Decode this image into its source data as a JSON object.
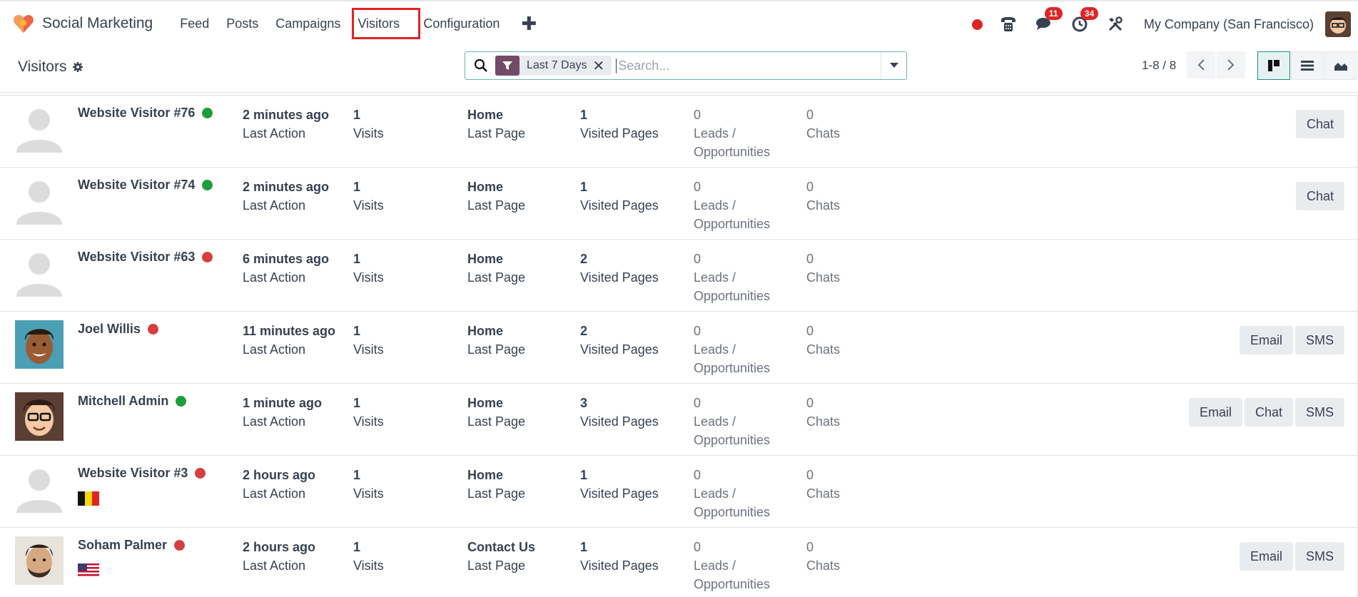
{
  "nav": {
    "app_name": "Social Marketing",
    "menu": [
      "Feed",
      "Posts",
      "Campaigns",
      "Visitors",
      "Configuration"
    ],
    "chat_badge": "11",
    "activity_badge": "34",
    "company": "My Company (San Francisco)"
  },
  "control": {
    "title": "Visitors",
    "facet": "Last 7 Days",
    "search_placeholder": "Search...",
    "pager": "1-8 / 8"
  },
  "labels": {
    "last_action": "Last Action",
    "visits": "Visits",
    "last_page": "Last Page",
    "visited_pages": "Visited Pages",
    "leads_1": "Leads /",
    "leads_2": "Opportunities",
    "chats": "Chats"
  },
  "colors": {
    "online": "#1e9e3a",
    "offline": "#d63f3f",
    "accent": "#714b67"
  },
  "visitors": [
    {
      "name": "Website Visitor #76",
      "status": "online",
      "avatar": "placeholder",
      "flag": "",
      "last_action": "2 minutes ago",
      "visits": "1",
      "last_page": "Home",
      "visited_pages": "1",
      "leads": "0",
      "chats": "0",
      "buttons": [
        "Chat"
      ]
    },
    {
      "name": "Website Visitor #74",
      "status": "online",
      "avatar": "placeholder",
      "flag": "",
      "last_action": "2 minutes ago",
      "visits": "1",
      "last_page": "Home",
      "visited_pages": "1",
      "leads": "0",
      "chats": "0",
      "buttons": [
        "Chat"
      ]
    },
    {
      "name": "Website Visitor #63",
      "status": "offline",
      "avatar": "placeholder",
      "flag": "",
      "last_action": "6 minutes ago",
      "visits": "1",
      "last_page": "Home",
      "visited_pages": "2",
      "leads": "0",
      "chats": "0",
      "buttons": []
    },
    {
      "name": "Joel Willis",
      "status": "offline",
      "avatar": "joel",
      "flag": "",
      "last_action": "11 minutes ago",
      "visits": "1",
      "last_page": "Home",
      "visited_pages": "2",
      "leads": "0",
      "chats": "0",
      "buttons": [
        "Email",
        "SMS"
      ]
    },
    {
      "name": "Mitchell Admin",
      "status": "online",
      "avatar": "mitchell",
      "flag": "",
      "last_action": "1 minute ago",
      "visits": "1",
      "last_page": "Home",
      "visited_pages": "3",
      "leads": "0",
      "chats": "0",
      "buttons": [
        "Email",
        "Chat",
        "SMS"
      ]
    },
    {
      "name": "Website Visitor #3",
      "status": "offline",
      "avatar": "placeholder",
      "flag": "belgium-flag",
      "last_action": "2 hours ago",
      "visits": "1",
      "last_page": "Home",
      "visited_pages": "1",
      "leads": "0",
      "chats": "0",
      "buttons": []
    },
    {
      "name": "Soham Palmer",
      "status": "offline",
      "avatar": "soham",
      "flag": "us-flag",
      "last_action": "2 hours ago",
      "visits": "1",
      "last_page": "Contact Us",
      "visited_pages": "1",
      "leads": "0",
      "chats": "0",
      "buttons": [
        "Email",
        "SMS"
      ]
    }
  ]
}
